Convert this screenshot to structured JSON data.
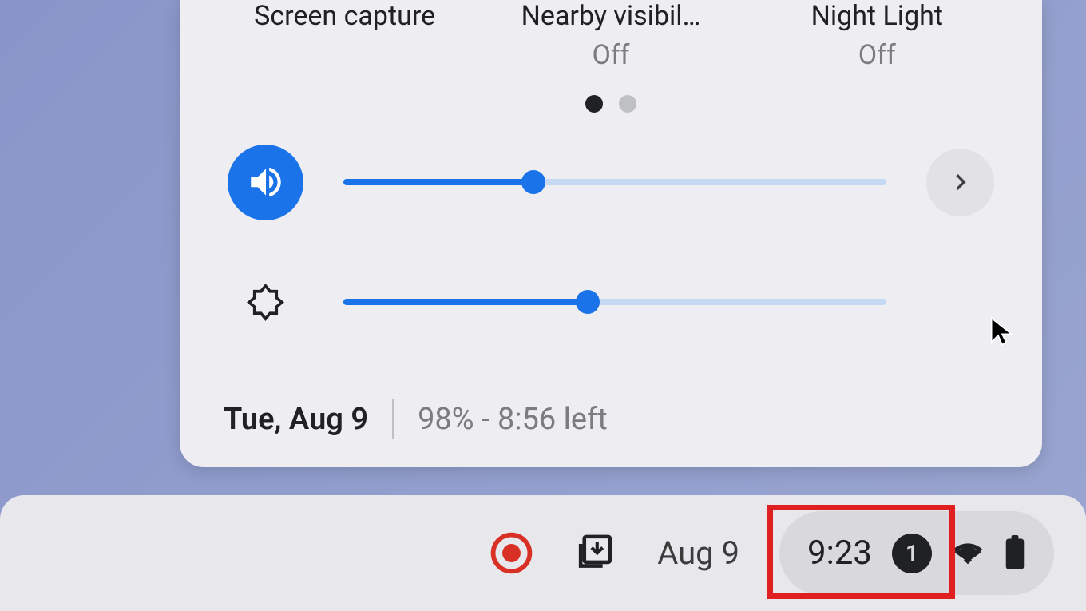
{
  "quick_tiles": [
    {
      "label": "Screen capture",
      "status": ""
    },
    {
      "label": "Nearby visibil…",
      "status": "Off"
    },
    {
      "label": "Night Light",
      "status": "Off"
    }
  ],
  "pager": {
    "active_index": 0,
    "count": 2
  },
  "sliders": {
    "volume": {
      "percent": 35
    },
    "brightness": {
      "percent": 45
    }
  },
  "panel_footer": {
    "date": "Tue, Aug 9",
    "battery": "98% - 8:56 left"
  },
  "shelf": {
    "date": "Aug 9",
    "time": "9:23",
    "notification_count": "1"
  }
}
